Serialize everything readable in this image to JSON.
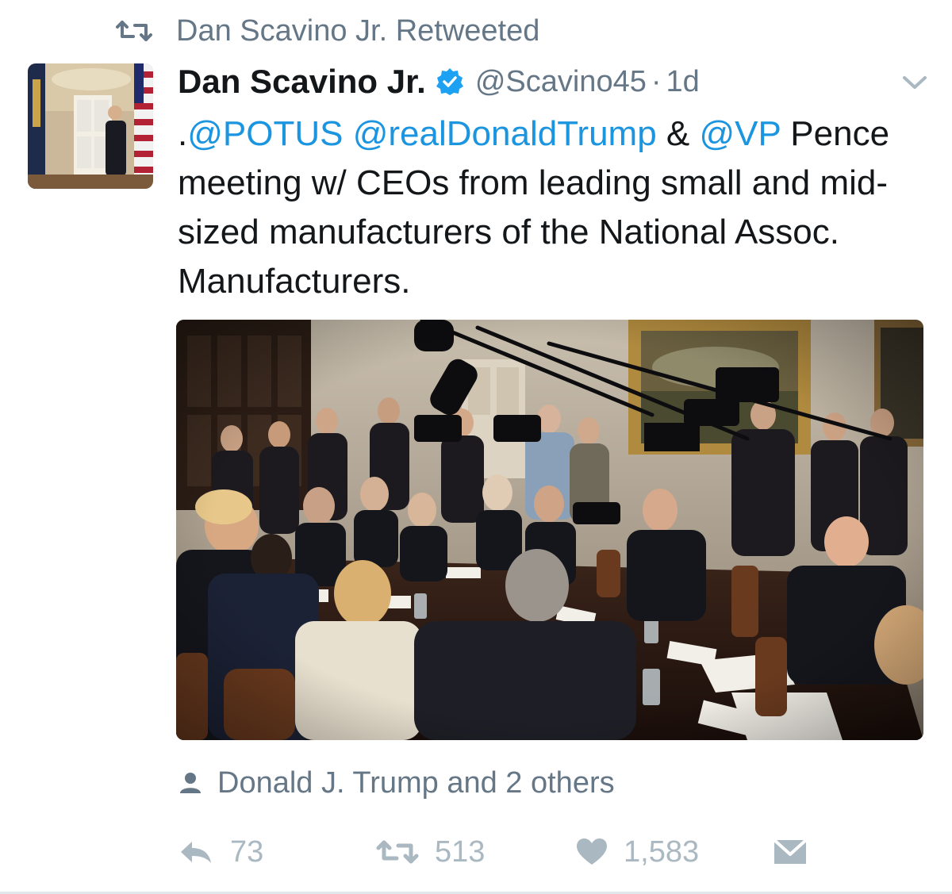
{
  "retweet_header": {
    "icon": "retweet-icon",
    "text": "Dan Scavino Jr. Retweeted"
  },
  "tweet": {
    "avatar_icon": "avatar",
    "display_name": "Dan Scavino Jr.",
    "verified_icon": "verified-badge-icon",
    "handle": "@Scavino45",
    "separator": "·",
    "time": "1d",
    "menu_icon": "chevron-down-icon",
    "text": {
      "t0": ".",
      "m1": "@POTUS",
      "t1": " ",
      "m2": "@realDonaldTrump",
      "t2": " & ",
      "m3": "@VP",
      "t3": " Pence meeting w/ CEOs from leading small and mid-sized manufacturers of the National Assoc. Manufacturers."
    },
    "media_icon": "photo-image",
    "tagged": {
      "icon": "person-icon",
      "text": "Donald J. Trump and 2 others"
    },
    "actions": {
      "reply": {
        "icon": "reply-icon",
        "count": "73"
      },
      "retweet": {
        "icon": "retweet-icon",
        "count": "513"
      },
      "like": {
        "icon": "heart-icon",
        "count": "1,583"
      },
      "dm": {
        "icon": "direct-message-icon"
      }
    }
  },
  "colors": {
    "link": "#1b95e0",
    "muted": "#657786",
    "action": "#aab8c2",
    "verified": "#1da1f2"
  }
}
